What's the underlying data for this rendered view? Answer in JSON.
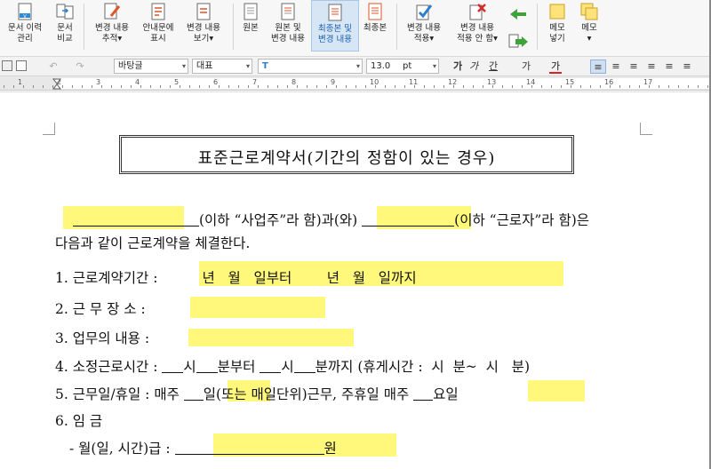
{
  "ribbon": {
    "buttons": [
      {
        "name": "doc-history-button",
        "label": "문서 이력\n관리"
      },
      {
        "name": "doc-compare-button",
        "label": "문서\n비교"
      },
      {
        "name": "track-changes-button",
        "label": "변경 내용\n추적▾"
      },
      {
        "name": "guide-text-button",
        "label": "안내문에\n표시"
      },
      {
        "name": "view-changes-button",
        "label": "변경 내용\n보기▾"
      },
      {
        "name": "original-button",
        "label": "원본"
      },
      {
        "name": "original-and-changes-button",
        "label": "원본 및\n변경 내용"
      },
      {
        "name": "final-and-changes-button",
        "label": "최종본 및\n변경 내용"
      },
      {
        "name": "final-button",
        "label": "최종본"
      },
      {
        "name": "apply-changes-button",
        "label": "변경 내용\n적용▾"
      },
      {
        "name": "reject-changes-button",
        "label": "변경 내용\n적용 안 함▾"
      },
      {
        "name": "insert-memo-button",
        "label": "메모\n넣기"
      },
      {
        "name": "memo-button",
        "label": "메모\n▾"
      }
    ]
  },
  "format": {
    "style": "바탕글",
    "lang": "대표",
    "font": "",
    "size": "13.0",
    "unit": "pt",
    "bold": "가",
    "italic": "가",
    "underline": "간",
    "strike": "가",
    "color": "가"
  },
  "ruler": {
    "numbers": [
      "1",
      "2",
      "3",
      "4",
      "5",
      "6",
      "7",
      "8",
      "9",
      "10",
      "11",
      "12",
      "13",
      "14",
      "15",
      "16",
      "17"
    ]
  },
  "document": {
    "title": "표준근로계약서(기간의 정함이 있는 경우)",
    "intro_a": "(이하 “사업주”라 함)과(와)",
    "intro_b": "(이하 “근로자”라 함)은",
    "intro_line2": "다음과 같이 근로계약을 체결한다.",
    "item1_label": "1. 근로계약기간 :",
    "item1_value": "년   월   일부터        년   월   일까지",
    "item2_label": "2. 근 무 장 소 :",
    "item3_label": "3. 업무의 내용 :",
    "item4_a": "4. 소정근로시간 :",
    "item4_b": "시",
    "item4_c": "분부터",
    "item4_d": "시",
    "item4_e": "분까지 (휴게시간 :  시  분~  시   분)",
    "item5_a": "5. 근무일/휴일 : 매주",
    "item5_b": "일(또는 매일단위)근무, 주휴일 매주",
    "item5_c": "요일",
    "item6": "6. 임   금",
    "item6_sub": "- 월(일, 시간)급 :",
    "item6_unit": "원"
  }
}
